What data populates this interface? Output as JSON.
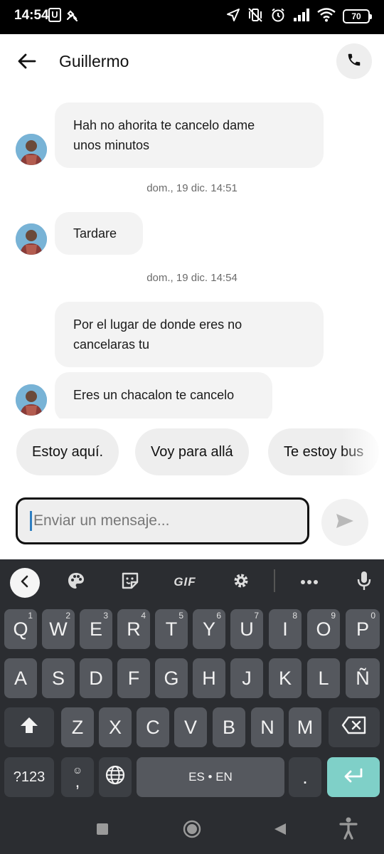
{
  "status_bar": {
    "time": "14:54",
    "carrier_badge": "U",
    "battery": "70",
    "icons": [
      "satellite-icon",
      "location-arrow-icon",
      "vibrate-off-icon",
      "alarm-icon",
      "signal-icon",
      "wifi-icon",
      "battery-icon"
    ]
  },
  "header": {
    "contact_name": "Guillermo",
    "back_icon": "arrow-left-icon",
    "call_icon": "phone-icon"
  },
  "messages": [
    {
      "type": "received",
      "text": "Hah no ahorita te cancelo dame unos minutos",
      "lines": [
        "Hah no ahorita te cancelo dame",
        "unos minutos"
      ],
      "avatar": true
    },
    {
      "type": "timestamp",
      "text": "dom., 19 dic. 14:51"
    },
    {
      "type": "received",
      "text": "Tardare",
      "lines": [
        "Tardare"
      ],
      "avatar": true
    },
    {
      "type": "timestamp",
      "text": "dom., 19 dic. 14:54"
    },
    {
      "type": "received",
      "text": "Por el lugar de donde eres no cancelaras tu",
      "lines": [
        "Por el lugar de donde eres no",
        "cancelaras tu"
      ],
      "avatar": false
    },
    {
      "type": "received",
      "text": "Eres un chacalon te cancelo",
      "lines": [
        "Eres un chacalon te cancelo"
      ],
      "avatar": true
    }
  ],
  "quick_replies": [
    "Estoy aquí.",
    "Voy para allá",
    "Te estoy bus"
  ],
  "composer": {
    "placeholder": "Enviar un mensaje...",
    "value": "",
    "send_icon": "send-icon"
  },
  "keyboard": {
    "toolbar": [
      "chevron-left-icon",
      "palette-icon",
      "sticker-icon",
      "GIF",
      "gear-icon",
      "more-icon",
      "mic-icon"
    ],
    "gif_label": "GIF",
    "rows": [
      [
        {
          "k": "Q",
          "h": "1"
        },
        {
          "k": "W",
          "h": "2"
        },
        {
          "k": "E",
          "h": "3"
        },
        {
          "k": "R",
          "h": "4"
        },
        {
          "k": "T",
          "h": "5"
        },
        {
          "k": "Y",
          "h": "6"
        },
        {
          "k": "U",
          "h": "7"
        },
        {
          "k": "I",
          "h": "8"
        },
        {
          "k": "O",
          "h": "9"
        },
        {
          "k": "P",
          "h": "0"
        }
      ],
      [
        {
          "k": "A"
        },
        {
          "k": "S"
        },
        {
          "k": "D"
        },
        {
          "k": "F"
        },
        {
          "k": "G"
        },
        {
          "k": "H"
        },
        {
          "k": "J"
        },
        {
          "k": "K"
        },
        {
          "k": "L"
        },
        {
          "k": "Ñ"
        }
      ],
      [
        {
          "k": "Z"
        },
        {
          "k": "X"
        },
        {
          "k": "C"
        },
        {
          "k": "V"
        },
        {
          "k": "B"
        },
        {
          "k": "N"
        },
        {
          "k": "M"
        }
      ]
    ],
    "symbols_label": "?123",
    "emoji_comma_label": ",",
    "space_label": "ES • EN",
    "period_label": "."
  },
  "nav_bar": [
    "recents-icon",
    "home-icon",
    "back-triangle-icon",
    "accessibility-icon"
  ]
}
